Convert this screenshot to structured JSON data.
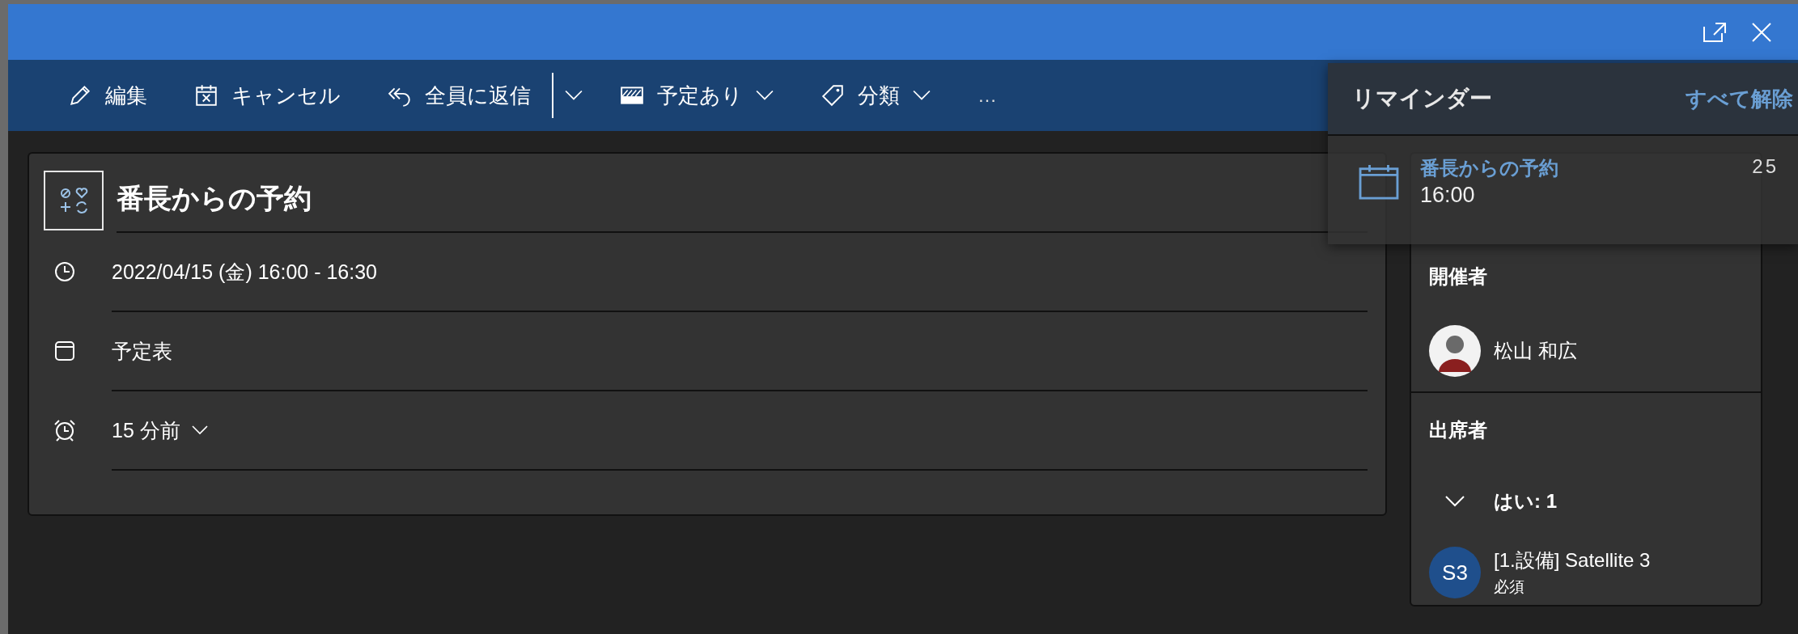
{
  "toolbar": {
    "items": [
      {
        "label": "編集",
        "kind": "button"
      },
      {
        "label": "キャンセル",
        "kind": "button"
      },
      {
        "label": "全員に返信",
        "kind": "split"
      },
      {
        "label": "予定あり",
        "kind": "dropdown"
      },
      {
        "label": "分類",
        "kind": "dropdown"
      },
      {
        "label": "…",
        "kind": "overflow"
      }
    ]
  },
  "event": {
    "title": "番長からの予約",
    "rows": [
      {
        "text": "2022/04/15 (金) 16:00 - 16:30",
        "kind": "text"
      },
      {
        "text": "予定表",
        "kind": "text"
      },
      {
        "text": "15 分前",
        "kind": "dropdown"
      }
    ]
  },
  "side": {
    "organizer": {
      "heading": "開催者",
      "name": "松山 和広"
    },
    "attendees": {
      "heading": "出席者",
      "groups": [
        {
          "label": "はい: 1",
          "expanded": true,
          "people": [
            {
              "initials": "S3",
              "name": "[1.設備] Satellite 3",
              "role": "必須"
            }
          ]
        }
      ]
    }
  },
  "reminder": {
    "title": "リマインダー",
    "dismiss_all": "すべて解除",
    "items": [
      {
        "title": "番長からの予約",
        "time": "16:00",
        "due": "25"
      }
    ]
  }
}
